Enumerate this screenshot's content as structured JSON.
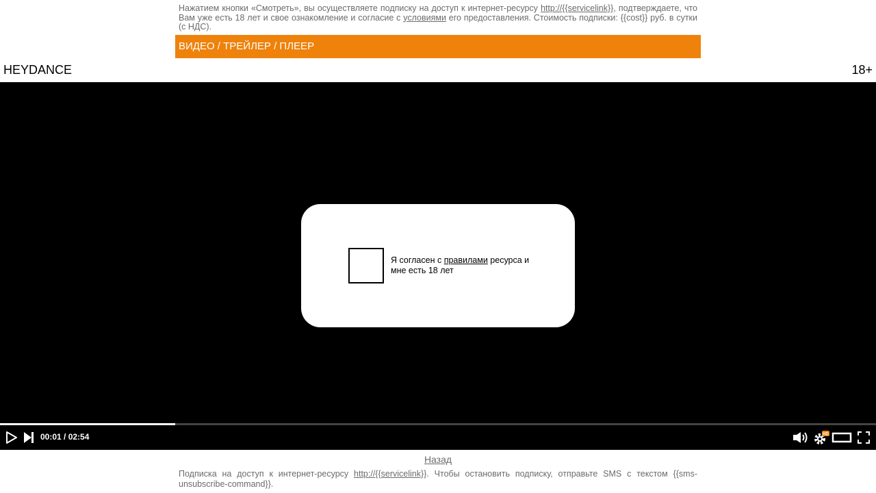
{
  "top_notice": {
    "part1": "Нажатием кнопки «Смотреть», вы осуществляете подписку на доступ к интернет-ресурсу ",
    "service_link": "http://{{servicelink}}",
    "part2": ", подтверждаете, что Вам уже есть 18 лет и свое ознакомление и согласие с ",
    "terms_link": "условиями",
    "part3": " его предоставления. Стоимость подписки: {{cost}} руб. в сутки (с НДС)."
  },
  "nav_bar": {
    "label": "ВИДЕО / ТРЕЙЛЕР / ПЛЕЕР"
  },
  "header": {
    "title": "HEYDANCE",
    "age_rating": "18+"
  },
  "consent": {
    "text_before": "Я согласен с ",
    "rules_link": "правилами",
    "text_after": " ресурса и мне есть 18 лет",
    "checked": false
  },
  "player": {
    "time_display": "00:01 / 02:54",
    "progress": 0.2,
    "settings_badge": "HD",
    "icons": {
      "play": "play-icon",
      "next": "skip-next-icon",
      "volume": "volume-icon",
      "settings": "gear-icon",
      "theater": "theater-mode-icon",
      "fullscreen": "fullscreen-icon"
    }
  },
  "back": {
    "label": "Назад"
  },
  "bottom_notice": {
    "part1": "Подписка на доступ к интернет-ресурсу ",
    "service_link": "http://{{servicelink}}",
    "part2": ". Чтобы остановить подписку, отправьте SMS с текстом {{sms-unsubscribe-command}}."
  },
  "colors": {
    "accent": "#ee820b",
    "text_muted": "#6b6b6b",
    "player_bg": "#000000",
    "badge": "#ee820b"
  }
}
